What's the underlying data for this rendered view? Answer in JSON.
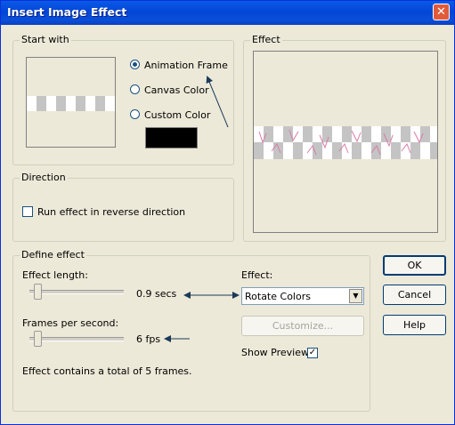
{
  "window": {
    "title": "Insert Image Effect",
    "close_glyph": "✕"
  },
  "start_with": {
    "group_label": "Start with",
    "options": {
      "animation_frame": "Animation Frame",
      "canvas_color": "Canvas Color",
      "custom_color": "Custom Color"
    },
    "selected": "animation_frame",
    "custom_color_value": "#000000"
  },
  "effect_preview": {
    "group_label": "Effect"
  },
  "direction": {
    "group_label": "Direction",
    "reverse_label": "Run effect in reverse direction",
    "reverse_checked": false
  },
  "define_effect": {
    "group_label": "Define effect",
    "length_label": "Effect length:",
    "length_value": "0.9 secs",
    "fps_label": "Frames per second:",
    "fps_value": "6 fps",
    "total_text": "Effect contains a total of 5 frames.",
    "effect_label": "Effect:",
    "effect_selected": "Rotate Colors",
    "customize_label": "Customize...",
    "show_preview_label": "Show Preview",
    "show_preview_checked": true
  },
  "buttons": {
    "ok": "OK",
    "cancel": "Cancel",
    "help": "Help"
  },
  "colors": {
    "title_bar": "#0a4fd8",
    "dialog_bg": "#ece9d8",
    "arrow": "#1c3a5a",
    "frame_overlay": "#d97aa6"
  }
}
